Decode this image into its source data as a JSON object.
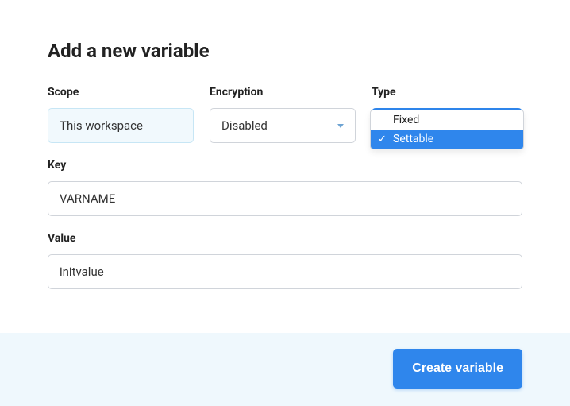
{
  "title": "Add a new variable",
  "fields": {
    "scope": {
      "label": "Scope",
      "value": "This workspace"
    },
    "encryption": {
      "label": "Encryption",
      "value": "Disabled"
    },
    "type": {
      "label": "Type",
      "options": [
        "Fixed",
        "Settable"
      ],
      "selected": "Settable"
    },
    "key": {
      "label": "Key",
      "value": "VARNAME"
    },
    "value": {
      "label": "Value",
      "value": "initvalue"
    }
  },
  "actions": {
    "submit": "Create variable"
  }
}
